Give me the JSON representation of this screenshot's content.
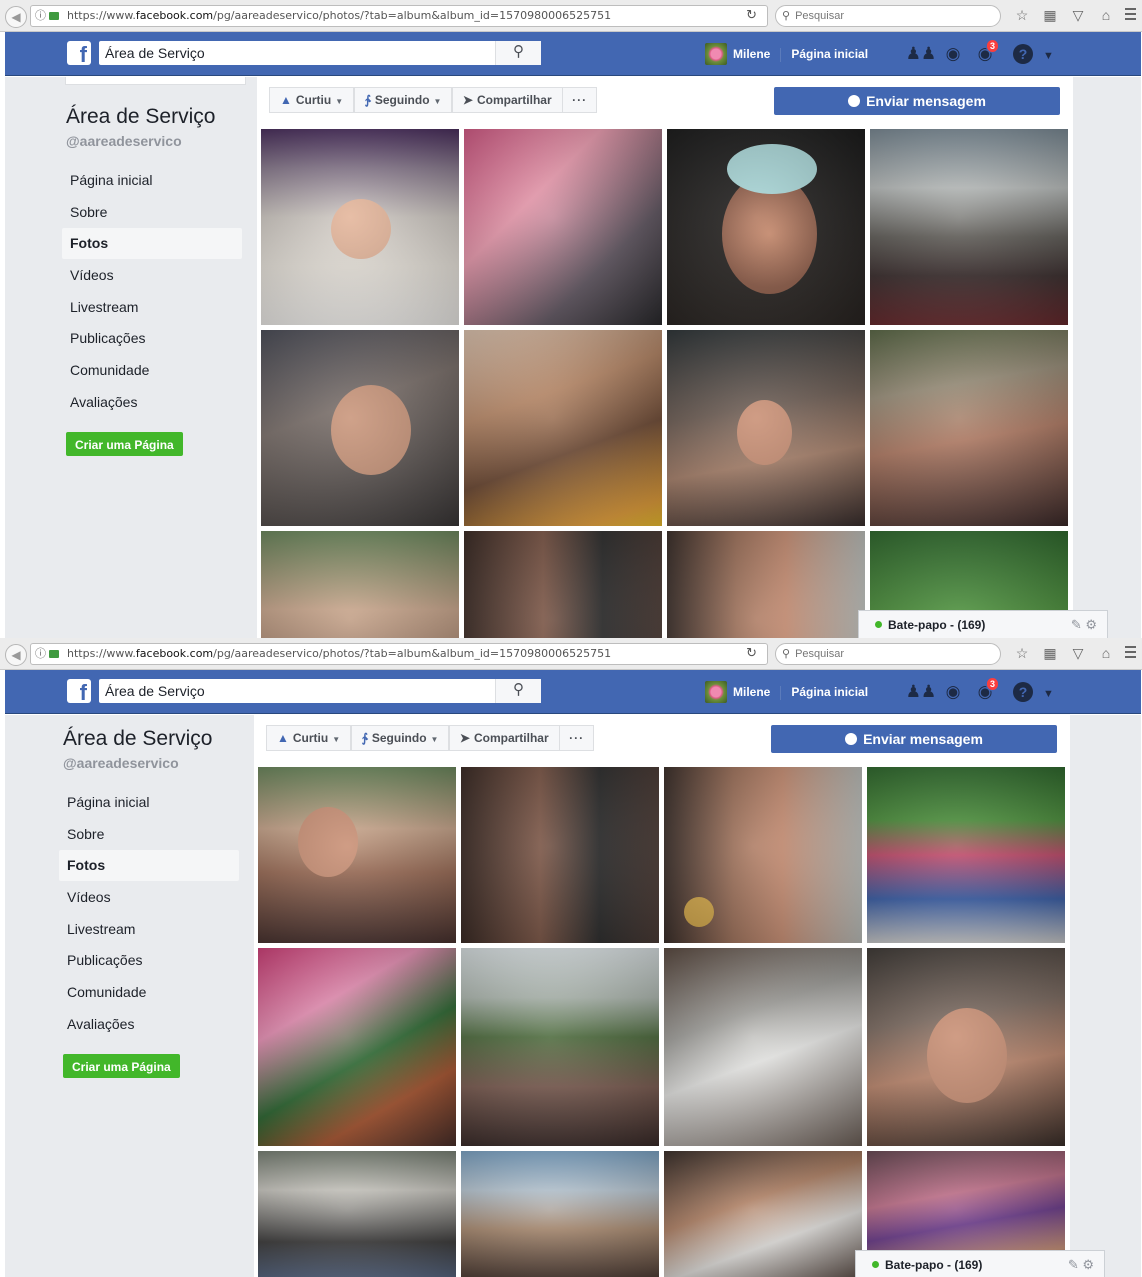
{
  "browser": {
    "url_prefix": "https://www.",
    "url_domain": "facebook.com",
    "url_rest": "/pg/aareadeservico/photos/?tab=album&album_id=1570980006525751",
    "search_placeholder": "Pesquisar"
  },
  "fb_header": {
    "search_value": "Área de Serviço",
    "user_name": "Milene",
    "home_label": "Página inicial",
    "notification_count": "3"
  },
  "sidebar": {
    "page_title": "Área de Serviço",
    "page_handle": "@aareadeservico",
    "items": [
      {
        "label": "Página inicial"
      },
      {
        "label": "Sobre"
      },
      {
        "label": "Fotos"
      },
      {
        "label": "Vídeos"
      },
      {
        "label": "Livestream"
      },
      {
        "label": "Publicações"
      },
      {
        "label": "Comunidade"
      },
      {
        "label": "Avaliações"
      }
    ],
    "active_item": "Fotos",
    "create_page_label": "Criar uma Página"
  },
  "actions": {
    "like_label": "Curtiu",
    "follow_label": "Seguindo",
    "share_label": "Compartilhar",
    "more_label": "···",
    "message_label": "Enviar mensagem"
  },
  "chat": {
    "label": "Bate-papo - (169)"
  },
  "colors": {
    "facebook_blue": "#4267b2",
    "create_green": "#42b72a",
    "online_green": "#42b72a"
  }
}
